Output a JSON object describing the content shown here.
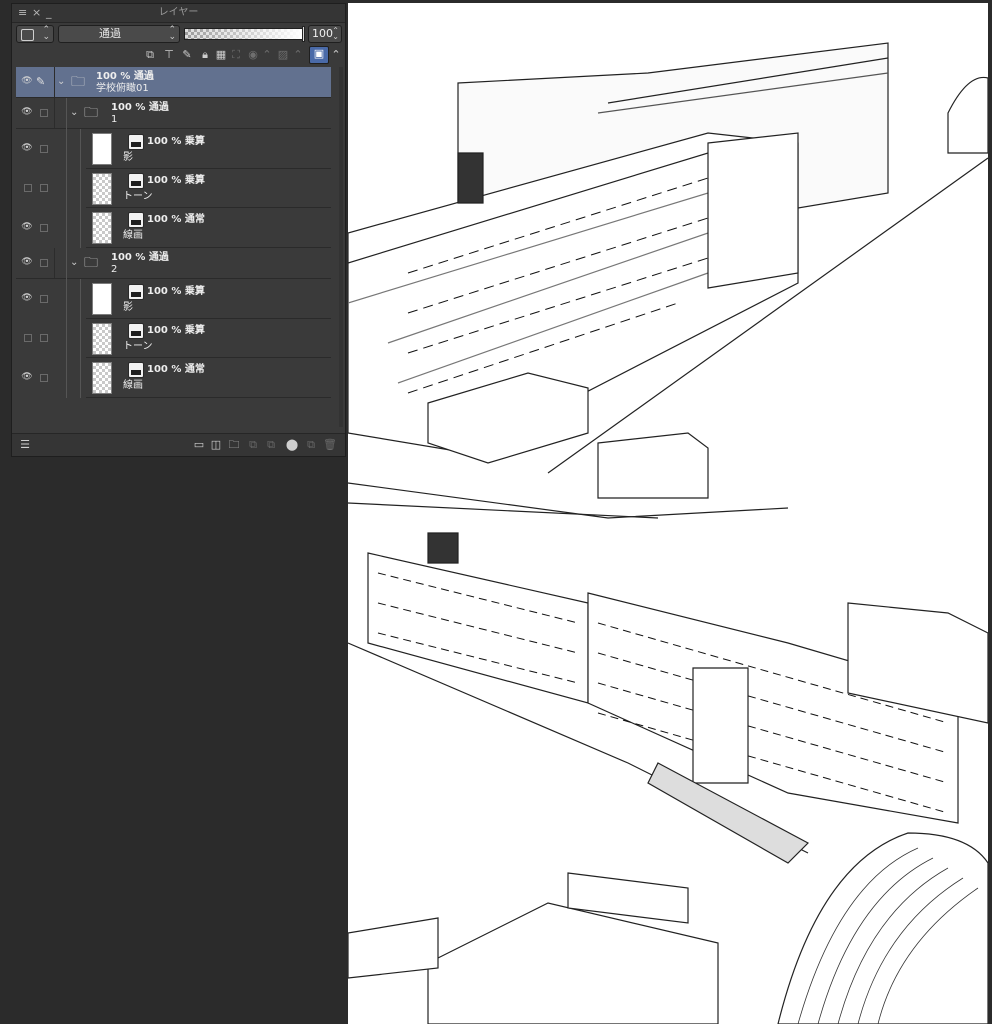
{
  "panel": {
    "title": "レイヤー",
    "controls": {
      "menu": "≡",
      "close": "×",
      "minimize": "_"
    },
    "blend_mode": "通過",
    "opacity_value": "100",
    "opacity_fraction": 1.0
  },
  "layers": [
    {
      "opacity_mode": "100 % 通過",
      "name": "学校俯瞰01",
      "visible": true,
      "selected": true,
      "editing": true,
      "kind": "folder"
    },
    {
      "opacity_mode": "100 % 通過",
      "name": "1",
      "visible": true,
      "kind": "folder"
    },
    {
      "opacity_mode": "100 % 乗算",
      "name": "影",
      "visible": true,
      "kind": "layer",
      "thumb": "white"
    },
    {
      "opacity_mode": "100 % 乗算",
      "name": "トーン",
      "visible": false,
      "kind": "layer",
      "thumb": "checker"
    },
    {
      "opacity_mode": "100 % 通常",
      "name": "線画",
      "visible": true,
      "kind": "layer",
      "thumb": "checker"
    },
    {
      "opacity_mode": "100 % 通過",
      "name": "2",
      "visible": true,
      "kind": "folder"
    },
    {
      "opacity_mode": "100 % 乗算",
      "name": "影",
      "visible": true,
      "kind": "layer",
      "thumb": "white"
    },
    {
      "opacity_mode": "100 % 乗算",
      "name": "トーン",
      "visible": false,
      "kind": "layer",
      "thumb": "checker"
    },
    {
      "opacity_mode": "100 % 通常",
      "name": "線画",
      "visible": true,
      "kind": "layer",
      "thumb": "checker"
    }
  ],
  "icons": {
    "eye": "eye-icon",
    "pen": "pen-icon",
    "folder": "folder-icon",
    "chevron": "chevron-down-icon",
    "mask": "layer-mask-icon"
  },
  "colors": {
    "panel_bg": "#3a3a3a",
    "selected_row": "#62718f",
    "canvas": "#ffffff",
    "workspace": "#2b2b2b"
  }
}
